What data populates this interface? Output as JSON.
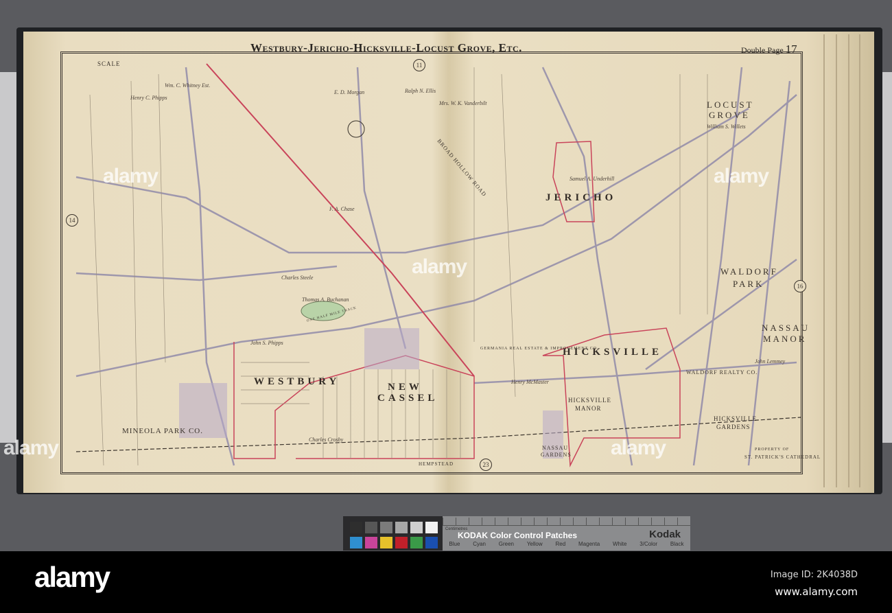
{
  "map": {
    "title": "Westbury-Jericho-Hicksville-Locust Grove, Etc.",
    "double_page_label": "Double Page",
    "double_page_number": "17",
    "adjacent_pages": [
      "11",
      "14",
      "16",
      "23"
    ],
    "places": {
      "westbury": "WESTBURY",
      "new_cassel_1": "NEW",
      "new_cassel_2": "CASSEL",
      "hicksville": "HICKSVILLE",
      "jericho": "JERICHO",
      "locust_grove_1": "LOCUST",
      "locust_grove_2": "GROVE",
      "waldorf_park_1": "WALDORF",
      "waldorf_park_2": "PARK",
      "nassau_manor_1": "NASSAU",
      "nassau_manor_2": "MANOR",
      "mineola_park": "MINEOLA PARK CO.",
      "hicksville_manor_1": "HICKSVILLE",
      "hicksville_manor_2": "MANOR",
      "hicksville_gardens_1": "HICKSVILLE",
      "hicksville_gardens_2": "GARDENS",
      "nassau_gardens_1": "NASSAU",
      "nassau_gardens_2": "GARDENS",
      "waldorf_realty": "WALDORF REALTY CO.",
      "st_patricks_1": "PROPERTY OF",
      "st_patricks_2": "ST. PATRICK'S CATHEDRAL",
      "germania": "GERMANIA REAL ESTATE & IMPROVEMENT CO",
      "hempstead": "HEMPSTEAD",
      "broad_hollow": "BROAD HOLLOW ROAD",
      "half_mile_track": "ONE HALF MILE TRACK"
    },
    "owners": [
      "E. D. Morgan",
      "Ralph N. Ellis",
      "Wm. C. Whitney Est.",
      "Henry C. Phipps",
      "John S. Phipps",
      "Charles Steele",
      "Samuel A. Underhill",
      "William S. Willets",
      "Charles Crosby",
      "Thomas A. Buchanan",
      "Henry McMaster",
      "John Lemmey",
      "Mrs. W. K. Vanderbilt",
      "F. A. Chase"
    ],
    "scale_label": "SCALE"
  },
  "kodak": {
    "title": "KODAK Color Control Patches",
    "brand": "Kodak",
    "ruler_label": "Centimetres",
    "patches": [
      "Blue",
      "Cyan",
      "Green",
      "Yellow",
      "Red",
      "Magenta",
      "White",
      "3/Color",
      "Black"
    ],
    "colors": [
      "#2f8fd0",
      "#c9449a",
      "#e7c12b",
      "#c0202a",
      "#3a9a48",
      "#1a4fb0"
    ],
    "grays": [
      "#2e2e2e",
      "#575757",
      "#7b7b7b",
      "#a7a7a7",
      "#cfcfcf",
      "#f2f2f2"
    ]
  },
  "footer": {
    "brand": "alamy",
    "image_id": "Image ID: 2K4038D",
    "url": "www.alamy.com"
  }
}
